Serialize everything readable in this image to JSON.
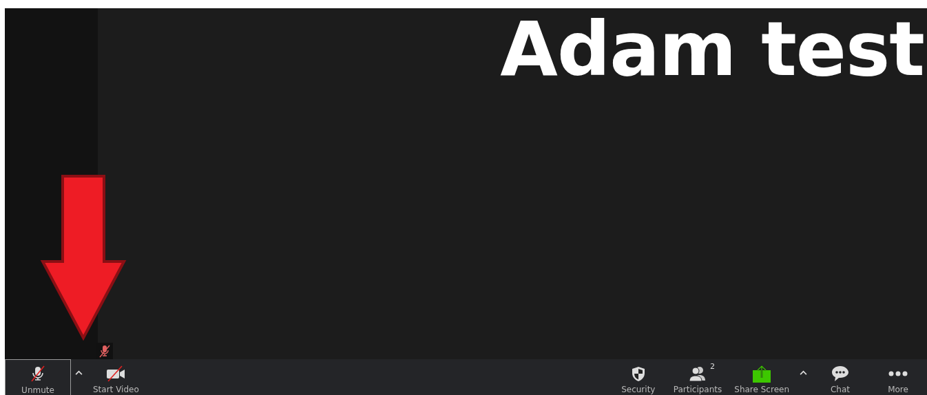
{
  "speaker_name": "Adam test",
  "self_view": {
    "muted": true
  },
  "toolbar": {
    "left": [
      {
        "kind": "mic",
        "label": "Unmute",
        "focused": true,
        "menu_caret": true,
        "off": true
      },
      {
        "kind": "video",
        "label": "Start Video",
        "focused": false,
        "menu_caret": false,
        "off": true
      }
    ],
    "right": [
      {
        "kind": "security",
        "label": "Security",
        "focused": false,
        "menu_caret": false
      },
      {
        "kind": "participants",
        "label": "Participants",
        "badge": "2",
        "focused": false,
        "menu_caret": false
      },
      {
        "kind": "share",
        "label": "Share Screen",
        "focused": false,
        "menu_caret": true
      },
      {
        "kind": "chat",
        "label": "Chat",
        "focused": false,
        "menu_caret": false
      },
      {
        "kind": "more",
        "label": "More",
        "focused": false,
        "menu_caret": false
      }
    ]
  }
}
